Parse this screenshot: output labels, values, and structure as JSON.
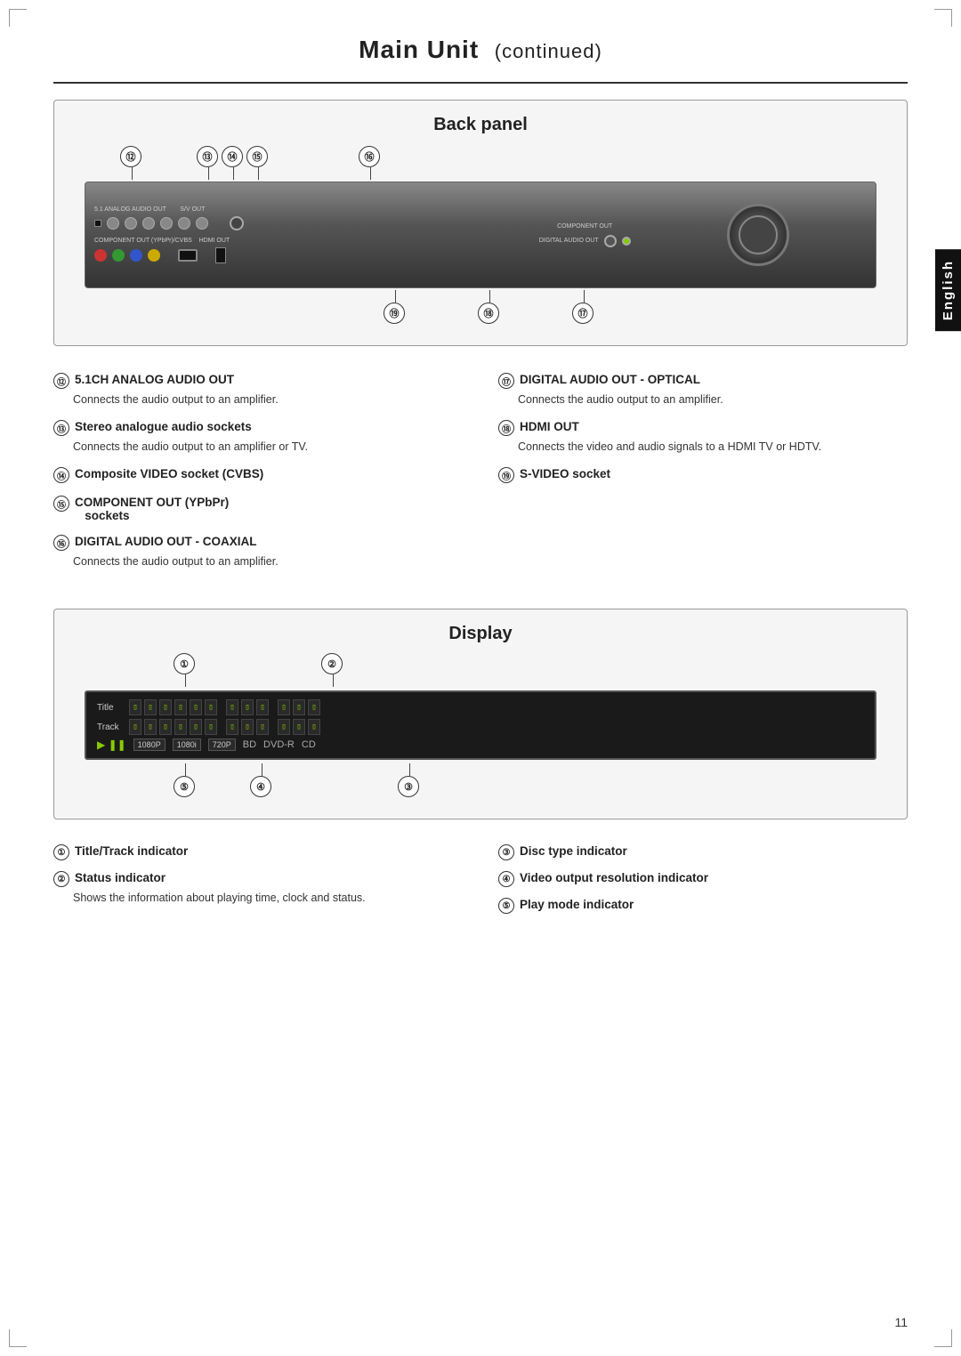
{
  "page": {
    "title": "Main Unit",
    "title_suffix": "continued",
    "page_number": "11",
    "language_tab": "English"
  },
  "back_panel": {
    "title": "Back panel",
    "callouts_top": [
      "⑫",
      "⑬⑭⑮",
      "⑯"
    ],
    "callouts_bottom": [
      "⑲",
      "⑱",
      "⑰"
    ],
    "items": [
      {
        "num": "⑫",
        "header": "5.1CH ANALOG AUDIO OUT",
        "text": "Connects the audio output to an amplifier."
      },
      {
        "num": "⑰",
        "header": "DIGITAL AUDIO OUT - OPTICAL",
        "text": "Connects the audio output to an amplifier."
      },
      {
        "num": "⑬",
        "header": "Stereo analogue audio sockets",
        "text": "Connects the audio output to an amplifier or TV."
      },
      {
        "num": "⑱",
        "header": "HDMI OUT",
        "text": "Connects the video and audio signals to a HDMI TV or HDTV."
      },
      {
        "num": "⑭",
        "header": "Composite VIDEO socket (CVBS)",
        "text": ""
      },
      {
        "num": "⑲",
        "header": "S-VIDEO socket",
        "text": ""
      },
      {
        "num": "⑮",
        "header": "COMPONENT OUT (YPbPr) sockets",
        "text": ""
      },
      {
        "num": "",
        "header": "",
        "text": ""
      },
      {
        "num": "⑯",
        "header": "DIGITAL AUDIO OUT - COAXIAL",
        "text": "Connects the audio output to an amplifier."
      },
      {
        "num": "",
        "header": "",
        "text": ""
      }
    ]
  },
  "display_panel": {
    "title": "Display",
    "callouts": [
      "①",
      "②",
      "③",
      "④",
      "⑤"
    ],
    "display_labels": {
      "title": "Title",
      "track": "Track"
    },
    "resolution_options": [
      "1080P",
      "1080i",
      "720P"
    ],
    "disc_types": [
      "BD",
      "DVD-R",
      "CD"
    ],
    "items": [
      {
        "num": "①",
        "header": "Title/Track indicator",
        "text": ""
      },
      {
        "num": "③",
        "header": "Disc type indicator",
        "text": ""
      },
      {
        "num": "②",
        "header": "Status indicator",
        "text": "Shows the information about playing time, clock and status."
      },
      {
        "num": "④",
        "header": "Video output resolution indicator",
        "text": ""
      },
      {
        "num": "",
        "header": "",
        "text": ""
      },
      {
        "num": "⑤",
        "header": "Play mode indicator",
        "text": ""
      }
    ]
  }
}
